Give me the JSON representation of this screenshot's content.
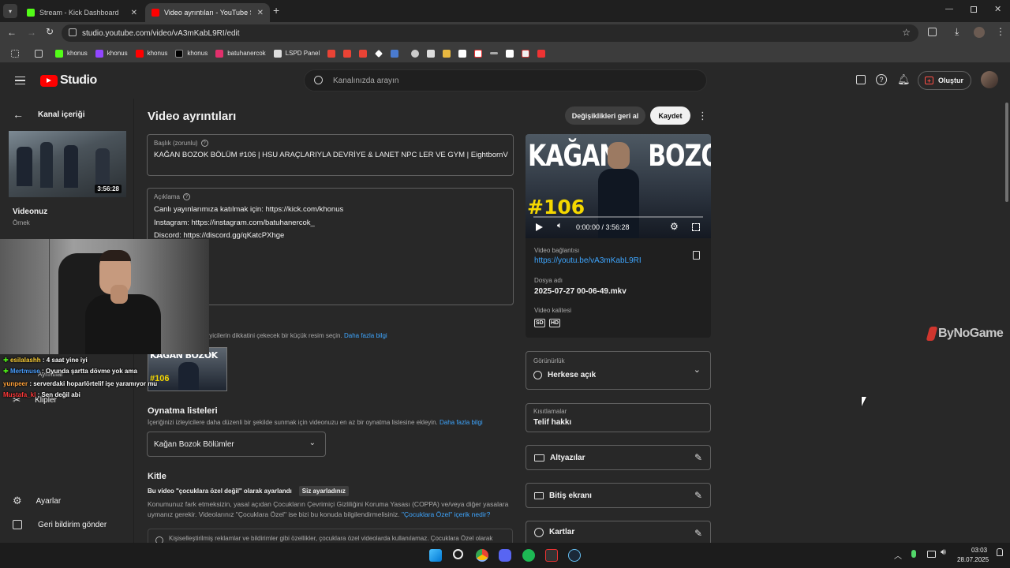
{
  "browser": {
    "tabs": [
      {
        "title": "Stream - Kick Dashboard",
        "color": "#53fc18"
      },
      {
        "title": "Video ayrıntıları - YouTube Studio",
        "color": "#ff0000"
      }
    ],
    "new_tab": "+",
    "url": "studio.youtube.com/video/vA3mKabL9RI/edit",
    "bookmarks": [
      {
        "label": "khonus",
        "color": "#53fc18"
      },
      {
        "label": "khonus",
        "color": "#9146ff"
      },
      {
        "label": "khonus",
        "color": "#ff0000"
      },
      {
        "label": "khonus",
        "color": "#ffffff"
      },
      {
        "label": "batuhanercok",
        "color": "#e1306c"
      },
      {
        "label": "LSPD Panel",
        "color": "#dddddd"
      }
    ]
  },
  "studio": {
    "logo_text": "Studio",
    "search_placeholder": "Kanalınızda arayın",
    "create_label": "Oluştur"
  },
  "sidebar": {
    "back_label": "Kanal içeriği",
    "thumb_duration": "3:56:28",
    "video_label": "Videonuz",
    "video_sub": "Örnek",
    "items": [
      "Ayrıntılar",
      "Klipler"
    ],
    "settings": "Ayarlar",
    "feedback": "Geri bildirim gönder"
  },
  "main": {
    "page_title": "Video ayrıntıları",
    "undo_label": "Değişiklikleri geri al",
    "save_label": "Kaydet",
    "title_label": "Başlık (zorunlu)",
    "title_value": "KAĞAN BOZOK BÖLÜM #106 | HSU ARAÇLARIYLA DEVRİYE & LANET NPC LER VE GYM | EightbornV",
    "desc_label": "Açıklama",
    "desc_lines": [
      "Canlı yayınlarımıza katılmak için:  https://kick.com/khonus",
      "Instagram: https://instagram.com/batuhanercok_",
      "Discord: https://discord.gg/qKatcPXhge"
    ],
    "thumb_help": "leyicilerin dikkatini çekecek bir küçük resim seçin.",
    "learn_more": "Daha fazla bilgi",
    "playlists_title": "Oynatma listeleri",
    "playlists_help": "İçeriğinizi izleyicilere daha düzenli bir şekilde sunmak için videonuzu en az bir oynatma listesine ekleyin.",
    "playlist_value": "Kağan Bozok Bölümler",
    "audience_title": "Kitle",
    "audience_status": "Bu video \"çocuklara özel değil\" olarak ayarlandı",
    "audience_badge": "Siz ayarladınız",
    "audience_text1": "Konumunuz fark etmeksizin, yasal açıdan Çocukların Çevrimiçi Gizliliğini Koruma Yasası (COPPA) ve/veya diğer yasalara",
    "audience_text2": "uymanız gerekir. Videolarınız \"Çocuklara Özel\" ise bizi bu konuda bilgilendirmelisiniz.",
    "audience_link": "\"Çocuklara Özel\" içerik nedir?",
    "audience_text3": "Kişiselleştirilmiş reklamlar ve bildirimler gibi özellikler, çocuklara özel videolarda kullanılamaz. Çocuklara Özel olarak"
  },
  "player": {
    "thumb_top": "KAĞAN    BOZOK",
    "thumb_number": "#106",
    "time": "0:00:00 / 3:56:28",
    "progress": 0,
    "link_label": "Video bağlantısı",
    "link": "https://youtu.be/vA3mKabL9RI",
    "file_label": "Dosya adı",
    "file": "2025-07-27 00-06-49.mkv",
    "quality_label": "Video kalitesi",
    "quality_sd": "SD",
    "quality_hd": "HD"
  },
  "right": {
    "visibility_label": "Görünürlük",
    "visibility_value": "Herkese açık",
    "restrictions_label": "Kısıtlamalar",
    "restrictions_value": "Telif hakkı",
    "subtitles": "Altyazılar",
    "end_screen": "Bitiş ekranı",
    "cards": "Kartlar"
  },
  "overlay": {
    "watermark": "ByNoGame",
    "mini_thumb_top": "KAĞAN BOZOK",
    "mini_thumb_number": "#106",
    "chat": [
      {
        "user": "esilalashh",
        "text": " : 4 saat yine iyi",
        "color": "#ffd23a"
      },
      {
        "user": "Mertmuse",
        "text": " : Oyunda şartta dövme yok ama",
        "color": "#4a9fff"
      },
      {
        "user": "yunpeer",
        "text": " : serverdaki hoparlörtelif işe yaramıyor mu",
        "color": "#ffa13a"
      },
      {
        "user": "Mustafa_kl",
        "text": " : Sen değil abi",
        "color": "#ff3a3a"
      }
    ]
  },
  "taskbar": {
    "time": "03:03",
    "date": "28.07.2025"
  }
}
